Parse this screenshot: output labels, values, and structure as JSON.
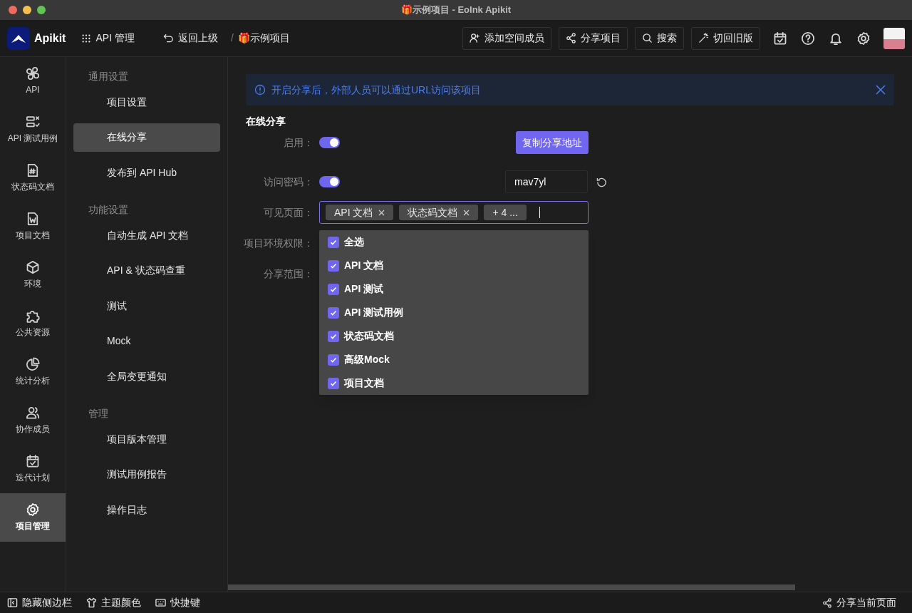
{
  "window": {
    "title": "🎁示例项目 - Eolnk Apikit"
  },
  "toolbar": {
    "logo": "Apikit",
    "app_menu": "API 管理",
    "back": "返回上级",
    "separator": "/",
    "project": "🎁示例项目",
    "actions": [
      {
        "label": "添加空间成员",
        "kind": "add-user"
      },
      {
        "label": "分享项目",
        "kind": "share"
      },
      {
        "label": "搜索",
        "kind": "search"
      },
      {
        "label": "切回旧版",
        "kind": "wand"
      }
    ],
    "icons": [
      {
        "kind": "calendar"
      },
      {
        "kind": "help"
      },
      {
        "kind": "bell"
      },
      {
        "kind": "settings"
      }
    ]
  },
  "nav_rail": [
    {
      "label": "API",
      "kind": "api",
      "selected": false
    },
    {
      "label": "API 测试用例",
      "kind": "testcase",
      "selected": false
    },
    {
      "label": "状态码文档",
      "kind": "hash-doc",
      "selected": false
    },
    {
      "label": "项目文档",
      "kind": "w-doc",
      "selected": false
    },
    {
      "label": "环境",
      "kind": "cube",
      "selected": false
    },
    {
      "label": "公共资源",
      "kind": "puzzle",
      "selected": false
    },
    {
      "label": "统计分析",
      "kind": "pie",
      "selected": false
    },
    {
      "label": "协作成员",
      "kind": "users",
      "selected": false
    },
    {
      "label": "迭代计划",
      "kind": "calendar",
      "selected": false
    },
    {
      "label": "项目管理",
      "kind": "settings",
      "selected": true
    }
  ],
  "settings_menu": [
    {
      "heading": "通用设置",
      "items": [
        {
          "label": "项目设置",
          "selected": false
        },
        {
          "label": "在线分享",
          "selected": true
        },
        {
          "label": "发布到 API Hub",
          "selected": false
        }
      ]
    },
    {
      "heading": "功能设置",
      "items": [
        {
          "label": "自动生成 API 文档",
          "selected": false
        },
        {
          "label": "API & 状态码查重",
          "selected": false
        },
        {
          "label": "测试",
          "selected": false
        },
        {
          "label": "Mock",
          "selected": false
        },
        {
          "label": "全局变更通知",
          "selected": false
        }
      ]
    },
    {
      "heading": "管理",
      "items": [
        {
          "label": "项目版本管理",
          "selected": false
        },
        {
          "label": "测试用例报告",
          "selected": false
        },
        {
          "label": "操作日志",
          "selected": false
        }
      ]
    }
  ],
  "notice": {
    "text": "开启分享后，外部人员可以通过URL访问该项目"
  },
  "section_title": "在线分享",
  "form": {
    "enable": {
      "label": "启用：",
      "on": true
    },
    "copy_button": "复制分享地址",
    "password": {
      "label": "访问密码：",
      "on": true,
      "value": "mav7yl"
    },
    "visible_pages": {
      "label": "可见页面：",
      "tags": [
        "API 文档",
        "状态码文档"
      ],
      "more": "+ 4 ...",
      "options": [
        {
          "label": "全选",
          "checked": true
        },
        {
          "label": "API 文档",
          "checked": true
        },
        {
          "label": "API 测试",
          "checked": true
        },
        {
          "label": "API 测试用例",
          "checked": true
        },
        {
          "label": "状态码文档",
          "checked": true
        },
        {
          "label": "高级Mock",
          "checked": true
        },
        {
          "label": "项目文档",
          "checked": true
        }
      ]
    },
    "env_permission": {
      "label": "项目环境权限："
    },
    "share_scope": {
      "label": "分享范围："
    }
  },
  "bottom_bar": {
    "items": [
      {
        "label": "隐藏侧边栏",
        "kind": "sidebar"
      },
      {
        "label": "主题颜色",
        "kind": "shirt"
      },
      {
        "label": "快捷键",
        "kind": "keyboard"
      }
    ],
    "share": "分享当前页面"
  }
}
